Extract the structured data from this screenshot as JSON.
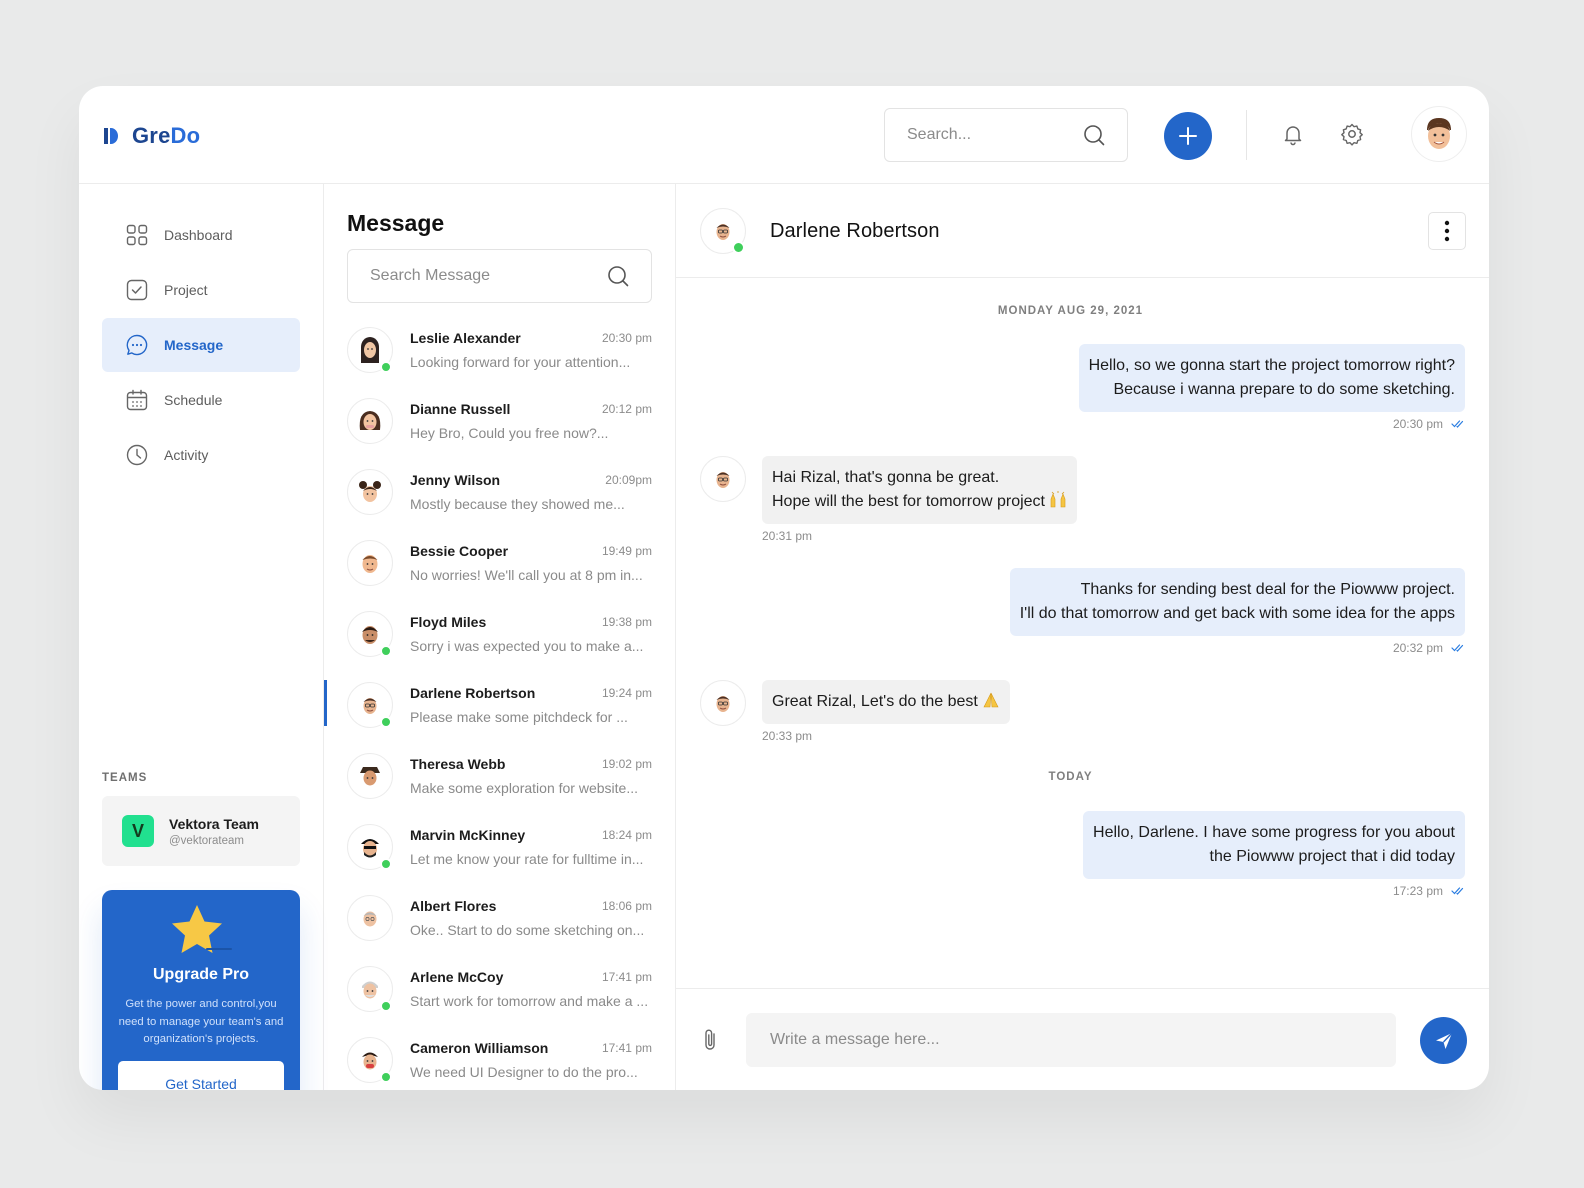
{
  "brand": {
    "name_part1": "Gre",
    "name_part2": "Do"
  },
  "header": {
    "search_placeholder": "Search..."
  },
  "sidebar": {
    "items": [
      {
        "label": "Dashboard",
        "icon": "grid-icon"
      },
      {
        "label": "Project",
        "icon": "checkbox-icon"
      },
      {
        "label": "Message",
        "icon": "chat-icon",
        "active": true
      },
      {
        "label": "Schedule",
        "icon": "calendar-icon"
      },
      {
        "label": "Activity",
        "icon": "clock-icon"
      }
    ],
    "teams_label": "TEAMS",
    "team": {
      "name": "Vektora Team",
      "handle": "@vektorateam",
      "logo_letter": "V"
    },
    "upgrade": {
      "title": "Upgrade Pro",
      "description": "Get the power and control,you need to manage your team's and organization's projects.",
      "button": "Get Started"
    }
  },
  "messages_panel": {
    "title": "Message",
    "search_placeholder": "Search Message",
    "conversations": [
      {
        "name": "Leslie Alexander",
        "time": "20:30 pm",
        "preview": "Looking forward for your attention...",
        "online": true
      },
      {
        "name": "Dianne Russell",
        "time": "20:12 pm",
        "preview": "Hey Bro, Could you free now?...",
        "online": false
      },
      {
        "name": "Jenny Wilson",
        "time": "20:09pm",
        "preview": "Mostly because they showed me...",
        "online": false
      },
      {
        "name": "Bessie Cooper",
        "time": "19:49 pm",
        "preview": "No worries! We'll call you at 8 pm in...",
        "online": false
      },
      {
        "name": "Floyd Miles",
        "time": "19:38 pm",
        "preview": "Sorry i was expected you to make a...",
        "online": true
      },
      {
        "name": "Darlene Robertson",
        "time": "19:24 pm",
        "preview": "Please make some pitchdeck for ...",
        "online": true,
        "active": true
      },
      {
        "name": "Theresa Webb",
        "time": "19:02 pm",
        "preview": "Make some exploration for website...",
        "online": false
      },
      {
        "name": "Marvin McKinney",
        "time": "18:24 pm",
        "preview": "Let me know your rate for fulltime in...",
        "online": true
      },
      {
        "name": "Albert Flores",
        "time": "18:06 pm",
        "preview": "Oke.. Start to do some sketching on...",
        "online": false
      },
      {
        "name": "Arlene McCoy",
        "time": "17:41 pm",
        "preview": "Start work for tomorrow and make a ...",
        "online": true
      },
      {
        "name": "Cameron Williamson",
        "time": "17:41 pm",
        "preview": "We need UI Designer to do the pro...",
        "online": true
      }
    ]
  },
  "chat": {
    "contact_name": "Darlene Robertson",
    "date_1": "MONDAY AUG 29, 2021",
    "msg_1": {
      "line1": "Hello, so we gonna start the project tomorrow right?",
      "line2": "Because i wanna prepare to do some sketching.",
      "time": "20:30 pm"
    },
    "msg_2": {
      "line1": "Hai Rizal, that's gonna be great.",
      "line2": "Hope will the best for tomorrow project",
      "time": "20:31 pm"
    },
    "msg_3": {
      "line1": "Thanks for sending best deal for the Piowww project.",
      "line2": "I'll do that tomorrow and get back with some idea for the apps",
      "time": "20:32 pm"
    },
    "msg_4": {
      "line1": "Great Rizal, Let's do the best",
      "time": "20:33 pm"
    },
    "date_2": "TODAY",
    "msg_5": {
      "line1": "Hello, Darlene. I have some progress for you about",
      "line2": "the Piowww project that i did today",
      "time": "17:23 pm"
    },
    "composer_placeholder": "Write a message here..."
  },
  "colors": {
    "accent": "#2366c9",
    "online": "#3fcf5b",
    "outgoing_bubble": "#e6eefb",
    "incoming_bubble": "#f1f1f1"
  }
}
